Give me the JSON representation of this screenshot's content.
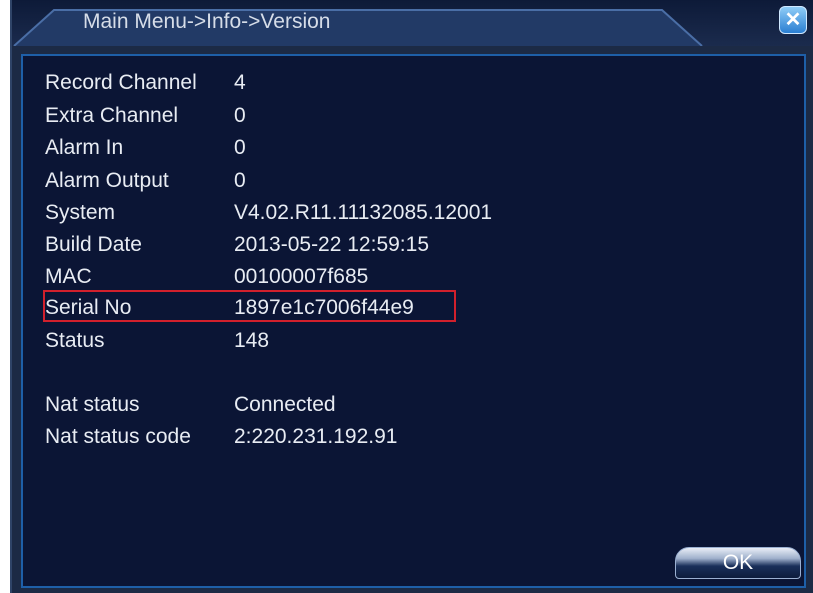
{
  "window": {
    "title": "Main Menu->Info->Version",
    "close_icon": "close-icon"
  },
  "info": [
    {
      "label": "Record Channel",
      "value": "4"
    },
    {
      "label": "Extra Channel",
      "value": "0"
    },
    {
      "label": "Alarm In",
      "value": "0"
    },
    {
      "label": "Alarm Output",
      "value": "0"
    },
    {
      "label": "System",
      "value": "V4.02.R11.11132085.12001"
    },
    {
      "label": "Build Date",
      "value": "2013-05-22 12:59:15"
    },
    {
      "label": "MAC",
      "value": "00100007f685"
    },
    {
      "label": "Serial No",
      "value": "1897e1c7006f44e9"
    },
    {
      "label": "Status",
      "value": "148"
    },
    {
      "label": "Nat status",
      "value": "Connected"
    },
    {
      "label": "Nat status code",
      "value": "2:220.231.192.91"
    }
  ],
  "buttons": {
    "ok_label": "OK"
  },
  "colors": {
    "background": "#0b1535",
    "frame": "#1c2a45",
    "border_accent": "#1e5fa8",
    "highlight": "#d2202c",
    "text": "#e8ecf3"
  }
}
